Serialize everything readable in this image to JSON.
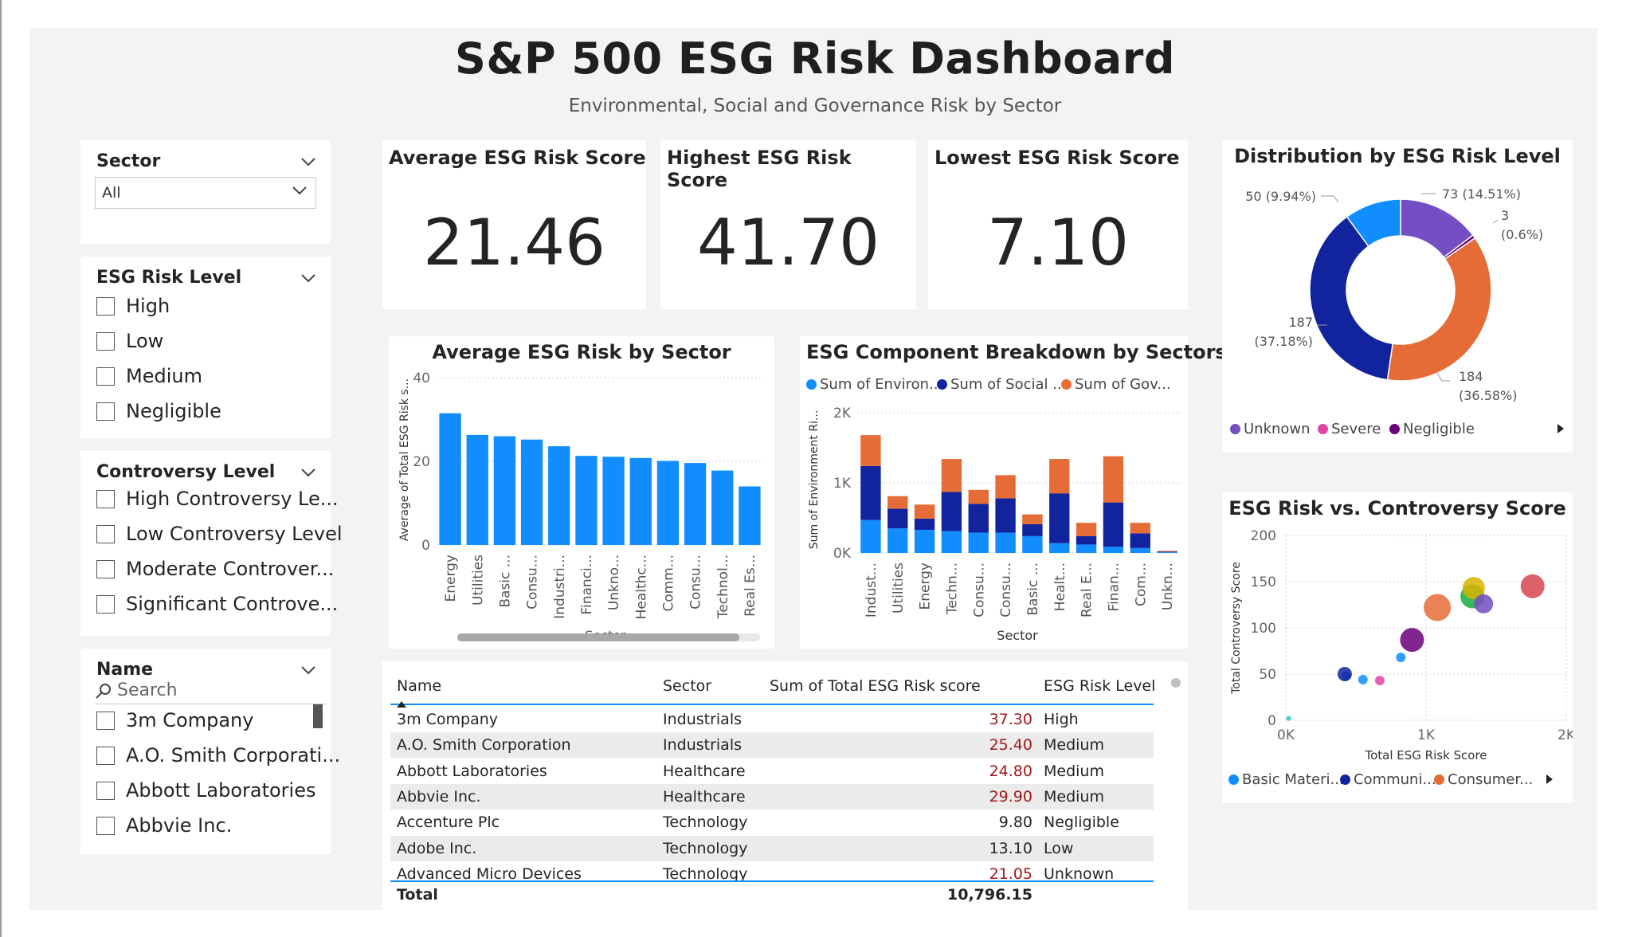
{
  "header": {
    "title": "S&P 500 ESG Risk Dashboard",
    "subtitle": "Environmental, Social and Governance Risk by Sector"
  },
  "slicers": {
    "sector": {
      "title": "Sector",
      "selected": "All"
    },
    "risk_level": {
      "title": "ESG Risk Level",
      "options": [
        "High",
        "Low",
        "Medium",
        "Negligible"
      ]
    },
    "controversy": {
      "title": "Controversy Level",
      "options": [
        "High Controversy Le...",
        "Low Controversy Level",
        "Moderate Controver...",
        "Significant Controve..."
      ]
    },
    "name": {
      "title": "Name",
      "search_placeholder": "Search",
      "options": [
        "3m Company",
        "A.O. Smith Corporati...",
        "Abbott Laboratories",
        "Abbvie Inc."
      ]
    }
  },
  "kpis": [
    {
      "title": "Average ESG Risk Score",
      "value": "21.46"
    },
    {
      "title": "Highest ESG Risk Score",
      "value": "41.70"
    },
    {
      "title": "Lowest ESG Risk Score",
      "value": "7.10"
    }
  ],
  "colors": {
    "primary": "#118dff",
    "navy": "#12239e",
    "orange": "#e66c37",
    "purple": "#744ec2",
    "pink": "#e044a7",
    "dark_purple": "#6b007b"
  },
  "chart_data": [
    {
      "type": "bar",
      "title": "Average ESG Risk by Sector",
      "xlabel": "Sector",
      "ylabel": "Average of Total ESG Risk s...",
      "ylim": [
        0,
        40
      ],
      "yticks": [
        "0",
        "20",
        "40"
      ],
      "categories": [
        "Energy",
        "Utilities",
        "Basic ...",
        "Consu...",
        "Industri...",
        "Financi...",
        "Unkno...",
        "Healthc...",
        "Comm...",
        "Consu...",
        "Technol...",
        "Real Es..."
      ],
      "values": [
        31.5,
        26.3,
        26.0,
        25.2,
        23.6,
        21.3,
        21.1,
        20.8,
        20.1,
        19.6,
        17.8,
        14.0
      ]
    },
    {
      "type": "bar",
      "stacked": true,
      "title": "ESG Component Breakdown by Sectors",
      "xlabel": "Sector",
      "ylabel": "Sum of Environment Ri...",
      "ylim": [
        0,
        2000
      ],
      "yticks": [
        "0K",
        "1K",
        "2K"
      ],
      "legend_labels": [
        "Sum of Environ...",
        "Sum of Social ...",
        "Sum of Gov..."
      ],
      "categories": [
        "Indust...",
        "Utilities",
        "Energy",
        "Techn...",
        "Consu...",
        "Consu...",
        "Basic ...",
        "Healt...",
        "Real E...",
        "Finan...",
        "Com...",
        "Unkn..."
      ],
      "series": [
        {
          "name": "Sum of Environ...",
          "values": [
            470,
            350,
            330,
            310,
            290,
            290,
            240,
            140,
            120,
            90,
            70,
            10
          ]
        },
        {
          "name": "Sum of Social ...",
          "values": [
            770,
            280,
            160,
            560,
            410,
            490,
            170,
            710,
            120,
            630,
            210,
            10
          ]
        },
        {
          "name": "Sum of Gov...",
          "values": [
            440,
            180,
            200,
            470,
            200,
            330,
            140,
            490,
            190,
            660,
            150,
            10
          ]
        }
      ]
    },
    {
      "type": "pie",
      "donut": true,
      "title": "Distribution by ESG Risk Level",
      "legend_labels": [
        "Unknown",
        "Severe",
        "Negligible"
      ],
      "slices": [
        {
          "label": "73 (14.51%)",
          "value": 73,
          "color": "#744ec2"
        },
        {
          "label": "3 (0.6%)",
          "value": 3,
          "color": "#6b007b"
        },
        {
          "label": "184 (36.58%)",
          "value": 184,
          "color": "#e66c37"
        },
        {
          "label": "187 (37.18%)",
          "value": 187,
          "color": "#12239e"
        },
        {
          "label": "50 (9.94%)",
          "value": 50,
          "color": "#118dff"
        }
      ]
    },
    {
      "type": "scatter",
      "title": "ESG Risk vs. Controversy Score",
      "xlabel": "Total ESG Risk Score",
      "ylabel": "Total Controversy Score",
      "xlim": [
        0,
        2000
      ],
      "ylim": [
        0,
        200
      ],
      "xticks": [
        "0K",
        "1K",
        "2K"
      ],
      "yticks": [
        "0",
        "50",
        "100",
        "150",
        "200"
      ],
      "legend_labels": [
        "Basic Materi...",
        "Communi...",
        "Consumer..."
      ],
      "points": [
        {
          "x": 20,
          "y": 2,
          "r": 3,
          "color": "#1fc5d0"
        },
        {
          "x": 430,
          "y": 48,
          "r": 6,
          "color": "#118dff"
        },
        {
          "x": 420,
          "y": 50,
          "r": 9,
          "color": "#12239e"
        },
        {
          "x": 550,
          "y": 44,
          "r": 6,
          "color": "#118dff"
        },
        {
          "x": 670,
          "y": 43,
          "r": 6,
          "color": "#e044a7"
        },
        {
          "x": 820,
          "y": 68,
          "r": 6,
          "color": "#118dff"
        },
        {
          "x": 900,
          "y": 87,
          "r": 15,
          "color": "#6b007b"
        },
        {
          "x": 1080,
          "y": 122,
          "r": 17,
          "color": "#e66c37"
        },
        {
          "x": 1330,
          "y": 134,
          "r": 15,
          "color": "#1aab40"
        },
        {
          "x": 1340,
          "y": 143,
          "r": 14,
          "color": "#d9b300"
        },
        {
          "x": 1410,
          "y": 126,
          "r": 12,
          "color": "#744ec2"
        },
        {
          "x": 1760,
          "y": 145,
          "r": 15,
          "color": "#d64550"
        }
      ]
    }
  ],
  "table": {
    "headers": [
      "Name",
      "Sector",
      "Sum of Total ESG Risk score",
      "ESG Risk Level"
    ],
    "rows": [
      [
        "3m Company",
        "Industrials",
        "37.30",
        "High"
      ],
      [
        "A.O. Smith Corporation",
        "Industrials",
        "25.40",
        "Medium"
      ],
      [
        "Abbott Laboratories",
        "Healthcare",
        "24.80",
        "Medium"
      ],
      [
        "Abbvie Inc.",
        "Healthcare",
        "29.90",
        "Medium"
      ],
      [
        "Accenture Plc",
        "Technology",
        "9.80",
        "Negligible"
      ],
      [
        "Adobe Inc.",
        "Technology",
        "13.10",
        "Low"
      ],
      [
        "Advanced Micro Devices",
        "Technology",
        "21.05",
        "Unknown"
      ]
    ],
    "total_label": "Total",
    "total_value": "10,796.15"
  }
}
